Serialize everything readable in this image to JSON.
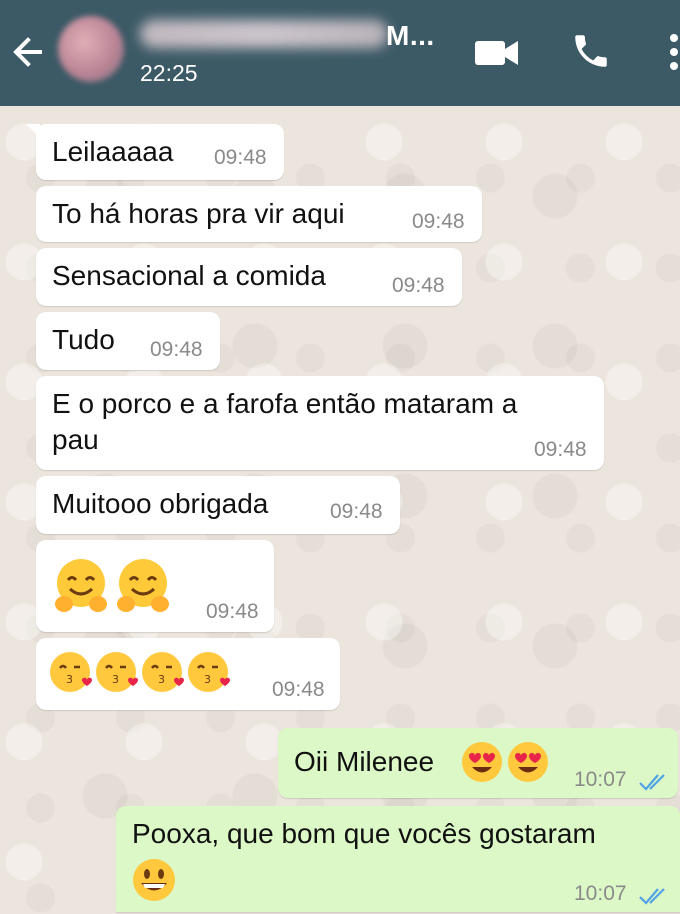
{
  "header": {
    "name_suffix": "M...",
    "time": "22:25"
  },
  "icons": {
    "back": "back-arrow-icon",
    "video": "video-call-icon",
    "call": "phone-icon",
    "menu": "more-vertical-icon"
  },
  "colors": {
    "header": "#3c5a66",
    "incoming": "#ffffff",
    "outgoing": "#dcf8c6",
    "read_ticks": "#4fa3e6"
  },
  "messages": [
    {
      "text": "Leilaaaaa",
      "time": "09:48"
    },
    {
      "text": "To há horas pra vir aqui",
      "time": "09:48"
    },
    {
      "text": "Sensacional a comida",
      "time": "09:48"
    },
    {
      "text": "Tudo",
      "time": "09:48"
    },
    {
      "text_line1": "E o porco e a farofa então mataram a",
      "text_line2": "pau",
      "time": "09:48"
    },
    {
      "text": "Muitooo obrigada",
      "time": "09:48"
    },
    {
      "emojis": [
        "hugging-face",
        "hugging-face"
      ],
      "time": "09:48"
    },
    {
      "emojis": [
        "kissing-heart",
        "kissing-heart",
        "kissing-heart",
        "kissing-heart"
      ],
      "time": "09:48"
    },
    {
      "text": "Oii Milenee",
      "emojis": [
        "heart-eyes",
        "heart-eyes"
      ],
      "time": "10:07",
      "status": "read"
    },
    {
      "text": "Pooxa, que bom que vocês gostaram",
      "emojis": [
        "grinning-face"
      ],
      "time": "10:07",
      "status": "read"
    }
  ]
}
